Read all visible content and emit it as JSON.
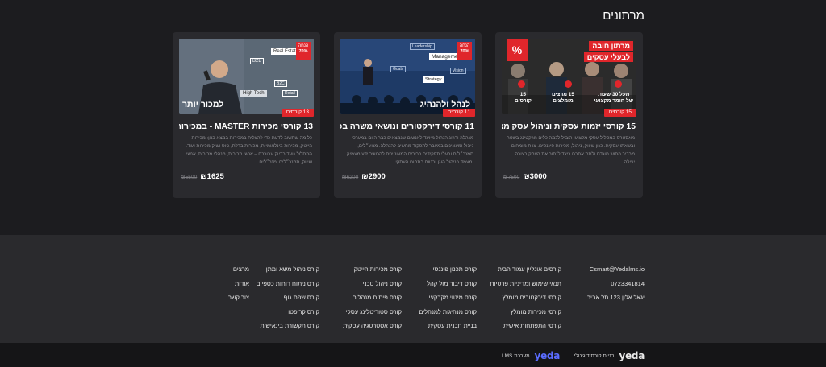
{
  "section": {
    "title": "מרתונים"
  },
  "cards": [
    {
      "thumb": {
        "headline_1": "מרתון חובה",
        "headline_2": "לבעלי עסקים",
        "percent": "%",
        "stats": [
          {
            "num": "15",
            "label": "קורסים"
          },
          {
            "num": "15 מרצים",
            "label": "מומלצים"
          },
          {
            "num": "מעל 30 שעות",
            "label": "של חומר מקצועי"
          }
        ]
      },
      "count": "15 קורסים",
      "title": "15 קורסי יזמות עסקית וניהול עסק מצליח",
      "description": "מאסטרס במסלול עסקי מקצועי הוביל לכמה כלים מרקטינג בשטח ובשאתו עסקית. כגון שיווק, ניהול, מכירות פיננסים. צוות מומחים מבכיר החוש מוגדם ולתת אתכם כיצד לנחור את העסק בצורה יעילה...",
      "price_old": "₪7500",
      "price_new": "₪3000"
    },
    {
      "thumb": {
        "corner_1": "הנחה",
        "corner_2": "70%",
        "caption": "לנהל ולהנהיג",
        "tags": [
          "Leadership",
          "Management",
          "Vision",
          "Strategy",
          "Goals"
        ]
      },
      "count": "11 קורסים",
      "title": "11 קורסי דירקטורים ונושאי משרה בכירה",
      "description": "מנהלה ודרוג הנהול מיועד לאנשים שנמצאים כבר היום במערכי ניהול ומעונינים במעבר לתפקוד מחשיב להנהלה. מנוע״לים, סמנכ״לים ובעלי תפקידים בכירים המעוניינים להכשיר ידע מעמיק ומעמד בניהול הוגן ובטוח בתחום העסקי",
      "price_old": "₪6200",
      "price_new": "₪2900"
    },
    {
      "thumb": {
        "corner_1": "הנחה",
        "corner_2": "70%",
        "caption": "למכור יותר",
        "tags": [
          "Real Estate",
          "B2B",
          "B2C",
          "High Tech",
          "Retail"
        ]
      },
      "count": "13 קורסים",
      "title": "13 קורסי מכירות MASTER - במכירות",
      "description": "כל מה שתשוב לדעת כדי להצליח במכירות במצא באן: מכירות הייטק, מכירות בינלאומיות, מכירות בדלת, גיוס ושוק מכירות ועוד. המסלול נועד בדיוק עבורכם – אנשי מכירות, מנהלי מכירות, אנשי שיווק, סמנכ״לים ומנכ״לים",
      "price_old": "₪5500",
      "price_new": "₪1625"
    }
  ],
  "footer": {
    "contact": [
      "Csmart@Yedalms.io",
      "0723341814",
      "יגאל אלון 123 תל אביב"
    ],
    "col1": [
      "קורסים אונליין עמוד הבית",
      "תנאי שימוש ומדיניות פרטיות",
      "קורסי דירקטורים מומלץ",
      "קורסי מכירות מומלץ",
      "קורסי התפתחות אישית"
    ],
    "col2": [
      "קורס תכנון פיננסי",
      "קורס דיבור מול קהל",
      "קורס מיטוי מקרקעין",
      "קורס מנהיגות למנהלים",
      "בניית תכנית עסקית"
    ],
    "col3": [
      "קורס מכירות הייטק",
      "קורס ניהול טכני",
      "קורס פיתוח מנהלים",
      "קורס סטוריטלינג עסקי",
      "קורס אסטרטגיה עסקית"
    ],
    "col4": [
      "קורס ניהול משא ומתן",
      "קורס ניתוח דוחות כספיים",
      "קורס שפת גוף",
      "קורס קריפטו",
      "קורס תקשורת בינאישית"
    ],
    "col5": [
      "מרצים",
      "אודות",
      "צור קשר"
    ]
  },
  "bottom": {
    "brand1_text": "בניית קורס דיגיטלי",
    "brand1_logo": "yeda",
    "brand2_text": "מערכת LMS",
    "brand2_logo": "yeda"
  },
  "colors": {
    "accent": "#e0262b",
    "background": "#1c1c1f",
    "card": "#2a2a2e"
  }
}
